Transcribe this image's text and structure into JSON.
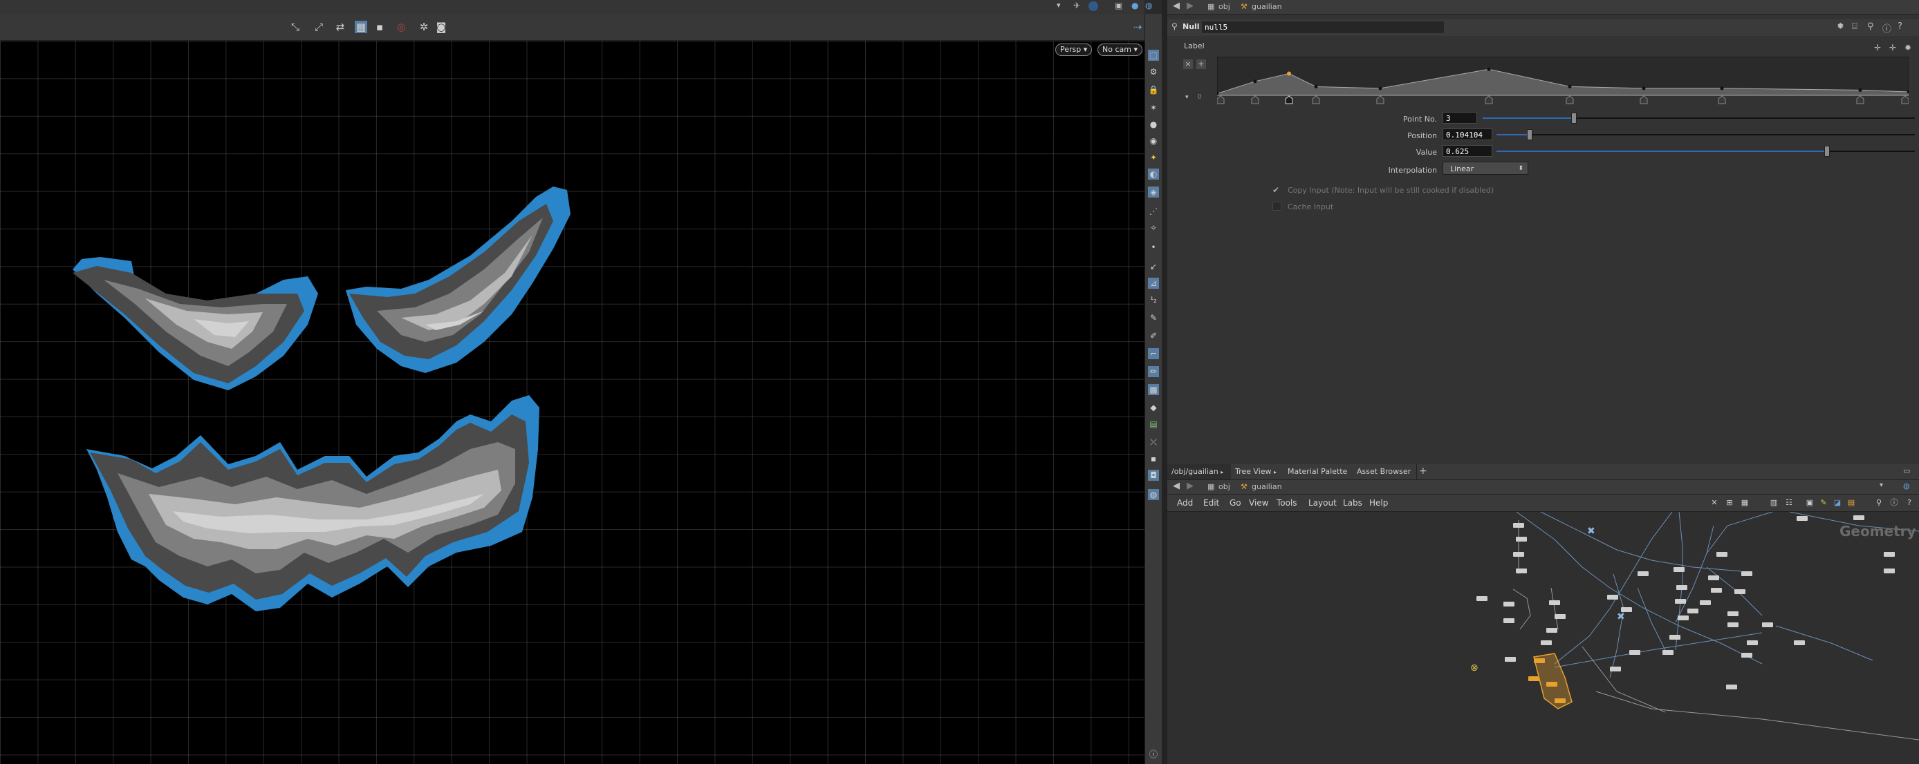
{
  "viewport": {
    "persp_label": "Persp",
    "cam_label": "No cam",
    "ramp_colors": {
      "blue": "#2a86c8",
      "dark": "#4a4a4a",
      "mid": "#7e7e7e",
      "light": "#b8b8b8",
      "lightest": "#d2d2d2"
    }
  },
  "param_panel": {
    "path": {
      "root": "obj",
      "node": "guailian"
    },
    "node_type": "Null",
    "node_name": "null5",
    "label_heading": "Label",
    "point_no": {
      "label": "Point No.",
      "value": "3"
    },
    "position": {
      "label": "Position",
      "value": "0.104104"
    },
    "value": {
      "label": "Value",
      "value": "0.625"
    },
    "interpolation": {
      "label": "Interpolation",
      "value": "Linear"
    },
    "copy_input": "Copy Input (Note: Input will be still cooked if disabled)",
    "cache_input": "Cache Input",
    "ramp_points": [
      0.0,
      0.055,
      0.104,
      0.143,
      0.236,
      0.393,
      0.51,
      0.617,
      0.73,
      0.93,
      1.0
    ],
    "ramp_values": [
      0.05,
      0.4,
      0.625,
      0.25,
      0.2,
      0.75,
      0.25,
      0.2,
      0.2,
      0.15,
      0.1
    ]
  },
  "network_panel": {
    "tabs": [
      "/obj/guailian",
      "Tree View",
      "Material Palette",
      "Asset Browser"
    ],
    "path": {
      "root": "obj",
      "node": "guailian"
    },
    "menu": [
      "Add",
      "Edit",
      "Go",
      "View",
      "Tools",
      "Layout",
      "Labs",
      "Help"
    ],
    "watermark": "Geometry"
  }
}
